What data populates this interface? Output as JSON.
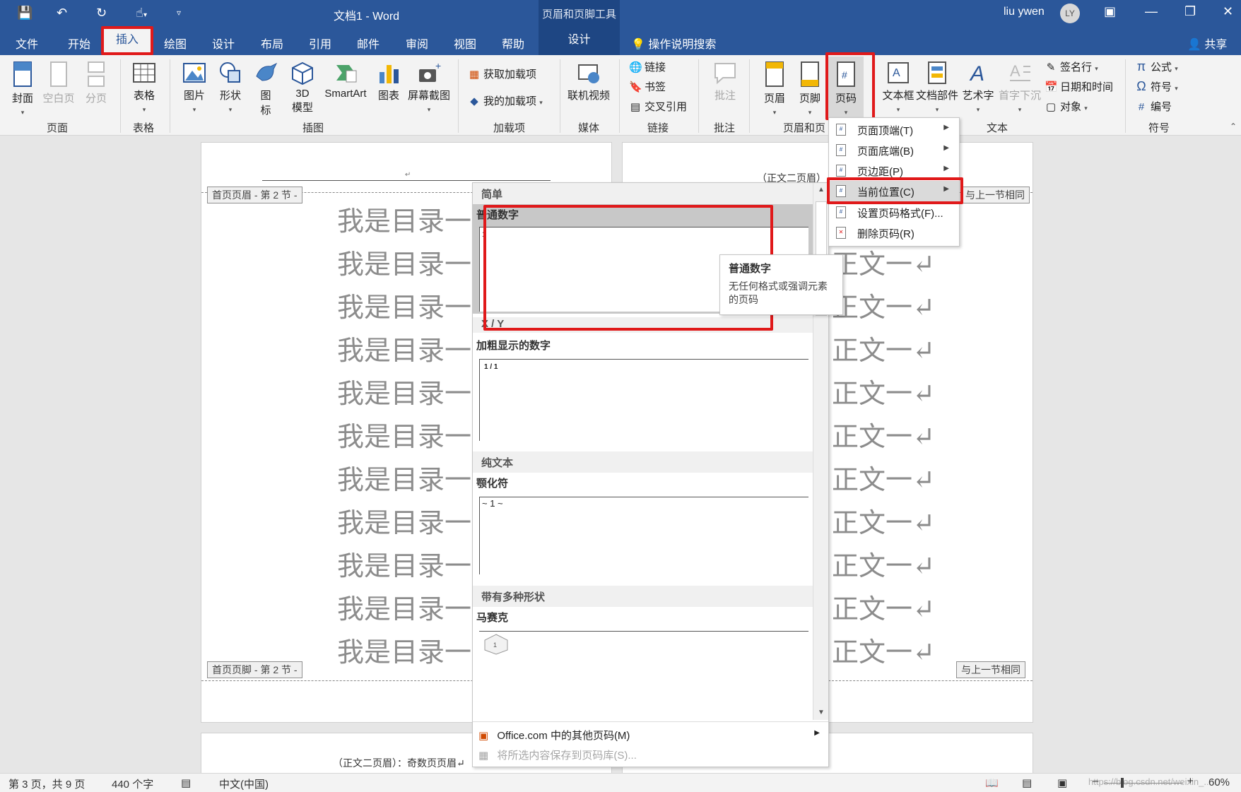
{
  "titlebar": {
    "doc_title": "文档1  -  Word",
    "context_title": "页眉和页脚工具",
    "user_name": "liu ywen",
    "user_initials": "LY"
  },
  "tabs": [
    "文件",
    "开始",
    "插入",
    "绘图",
    "设计",
    "布局",
    "引用",
    "邮件",
    "审阅",
    "视图",
    "帮助",
    "设计"
  ],
  "tellme": "操作说明搜索",
  "share": "共享",
  "ribbon": {
    "pages": {
      "cover": "封面",
      "blank": "空白页",
      "break": "分页",
      "group": "页面"
    },
    "table": {
      "table": "表格",
      "group": "表格"
    },
    "illustrations": {
      "picture": "图片",
      "shape": "形状",
      "icon1": "图",
      "icon2": "标",
      "model1": "3D",
      "model2": "模型",
      "smartart": "SmartArt",
      "chart": "图表",
      "screenshot": "屏幕截图",
      "group": "插图"
    },
    "addins": {
      "get": "获取加载项",
      "mine": "我的加载项",
      "group": "加载项"
    },
    "media": {
      "video": "联机视频",
      "group": "媒体"
    },
    "links": {
      "link": "链接",
      "bookmark": "书签",
      "crossref": "交叉引用",
      "group": "链接"
    },
    "comments": {
      "comment": "批注",
      "group": "批注"
    },
    "headerfooter": {
      "header": "页眉",
      "footer": "页脚",
      "pagenum": "页码",
      "group": "页眉和页"
    },
    "text": {
      "textbox": "文本框",
      "parts": "文档部件",
      "wordart": "艺术字",
      "dropcap": "首字下沉",
      "signature": "签名行",
      "datetime": "日期和时间",
      "object": "对象",
      "group": "文本"
    },
    "symbols": {
      "equation": "公式",
      "symbol": "符号",
      "number": "编号",
      "group": "符号"
    }
  },
  "doc": {
    "header_tag": "首页页眉 - 第 2 节 -",
    "footer_tag": "首页页脚 - 第 2 节 -",
    "same_as_prev": "与上一节相同",
    "toc_line": "我是目录一",
    "body_line": "正文一↵",
    "page2_header": "（正文二页眉）",
    "page3_header": "（正文二页眉）：奇数页页眉↵",
    "return_mark": "↵"
  },
  "gallery": {
    "sec_simple": "简单",
    "item_plain": "普通数字",
    "sec_xy": "X / Y",
    "item_bold": "加粗显示的数字",
    "bold_preview": "1 / 1",
    "sec_plaintext": "纯文本",
    "item_tilde": "颚化符",
    "tilde_preview": "~ 1 ~",
    "sec_shapes": "带有多种形状",
    "item_mosaic": "马赛克",
    "more": "Office.com 中的其他页码(M)",
    "save": "将所选内容保存到页码库(S)..."
  },
  "tooltip": {
    "title": "普通数字",
    "desc": "无任何格式或强调元素的页码"
  },
  "menu": {
    "top": "页面顶端(T)",
    "bottom": "页面底端(B)",
    "margin": "页边距(P)",
    "current": "当前位置(C)",
    "format": "设置页码格式(F)...",
    "remove": "删除页码(R)"
  },
  "status": {
    "page": "第 3 页，共 9 页",
    "words": "440 个字",
    "lang": "中文(中国)",
    "watermark": "https://blog.csdn.net/weixin_...",
    "zoom": "60%"
  },
  "colors": {
    "brand": "#2b579a",
    "highlight": "#e0191a"
  }
}
